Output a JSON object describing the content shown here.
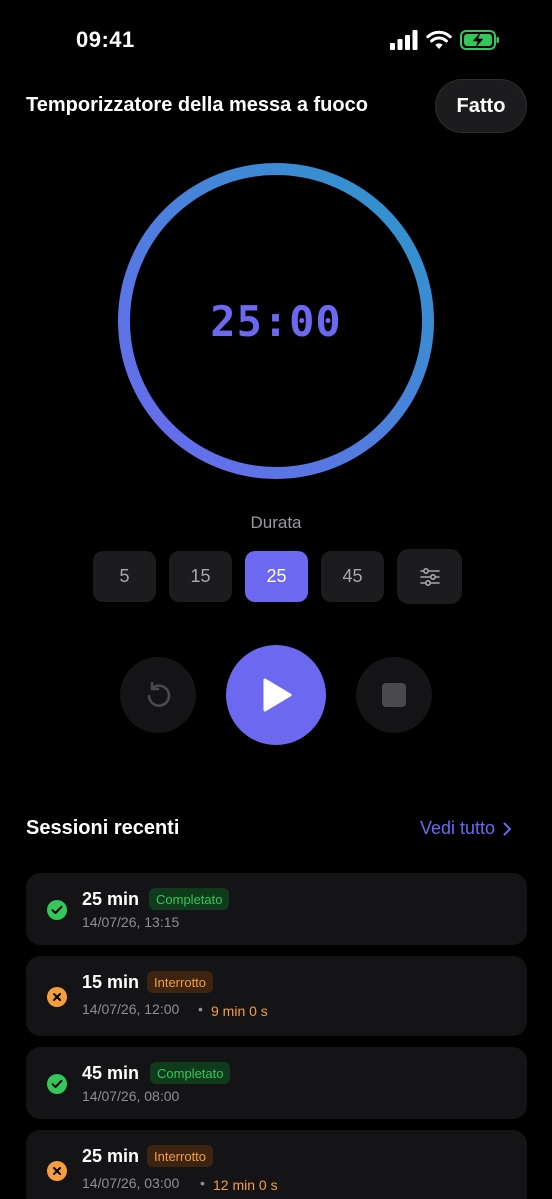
{
  "status_bar": {
    "time": "09:41"
  },
  "header": {
    "title": "Temporizzatore della messa a fuoco",
    "done_label": "Fatto"
  },
  "timer": {
    "display": "25:00",
    "progress": 1.0
  },
  "duration": {
    "label": "Durata",
    "presets": [
      "5",
      "15",
      "25",
      "45"
    ],
    "selected": "25"
  },
  "colors": {
    "accent": "#6d68f0",
    "ring_start": "#6d68f0",
    "ring_end": "#2b97c9",
    "completed": "#34c759",
    "interrupted": "#f59e3b"
  },
  "recent": {
    "title": "Sessioni recenti",
    "see_all": "Vedi tutto",
    "sessions": [
      {
        "duration": "25 min",
        "status": "Completato",
        "date": "14/07/26, 13:15"
      },
      {
        "duration": "15 min",
        "status": "Interrotto",
        "date": "14/07/26, 12:00",
        "separator": "•",
        "elapsed": "9 min 0 s"
      },
      {
        "duration": "45 min",
        "status": "Completato",
        "date": "14/07/26, 08:00"
      },
      {
        "duration": "25 min",
        "status": "Interrotto",
        "date": "14/07/26, 03:00",
        "separator": "•",
        "elapsed": "12 min 0 s"
      }
    ]
  },
  "icons": [
    "signal-icon",
    "wifi-icon",
    "battery-charging-icon",
    "sliders-icon",
    "reset-icon",
    "play-icon",
    "stop-icon",
    "chevron-right-icon",
    "check-icon",
    "x-icon"
  ]
}
